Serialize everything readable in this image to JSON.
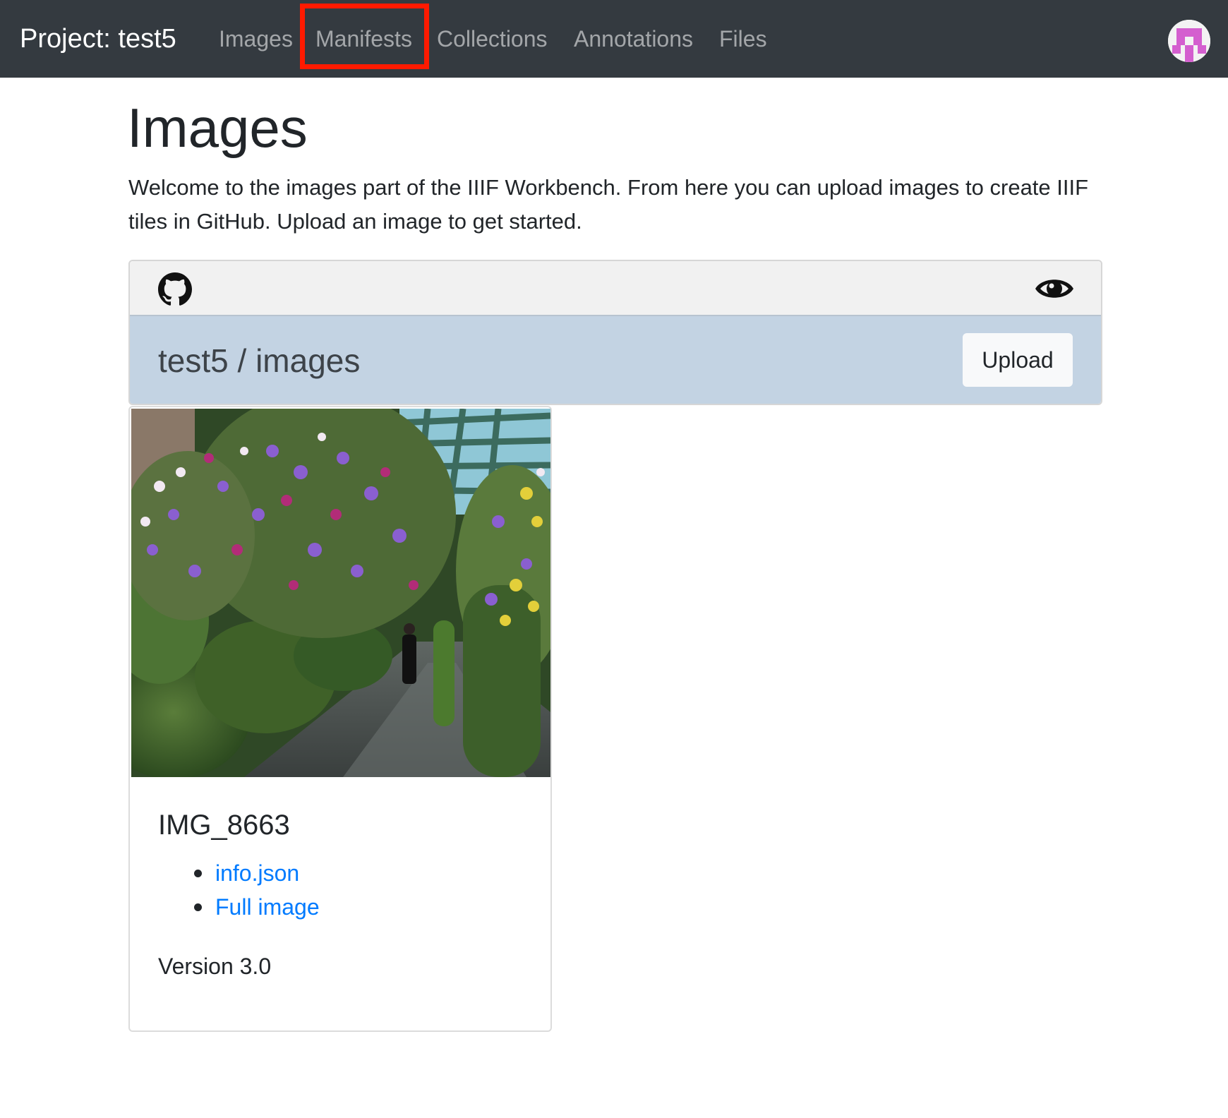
{
  "navbar": {
    "brand": "Project: test5",
    "items": [
      {
        "label": "Images"
      },
      {
        "label": "Manifests"
      },
      {
        "label": "Collections"
      },
      {
        "label": "Annotations"
      },
      {
        "label": "Files"
      }
    ],
    "highlighted_item": "Manifests",
    "highlight_color": "#ff1a00",
    "avatar_icon": "identicon-avatar",
    "avatar_color": "#d45fcf"
  },
  "main": {
    "title": "Images",
    "intro": "Welcome to the images part of the IIIF Workbench. From here you can upload images to create IIIF tiles in GitHub. Upload an image to get started."
  },
  "panel": {
    "toolbar_left_icon": "github-icon",
    "toolbar_right_icon": "eye-icon",
    "path": "test5 / images",
    "upload_label": "Upload",
    "header_color": "#c3d3e3"
  },
  "cards": [
    {
      "title": "IMG_8663",
      "thumbnail": "flower-garden-photo",
      "links": [
        {
          "label": "info.json"
        },
        {
          "label": "Full image"
        }
      ],
      "version": "Version 3.0"
    }
  ]
}
